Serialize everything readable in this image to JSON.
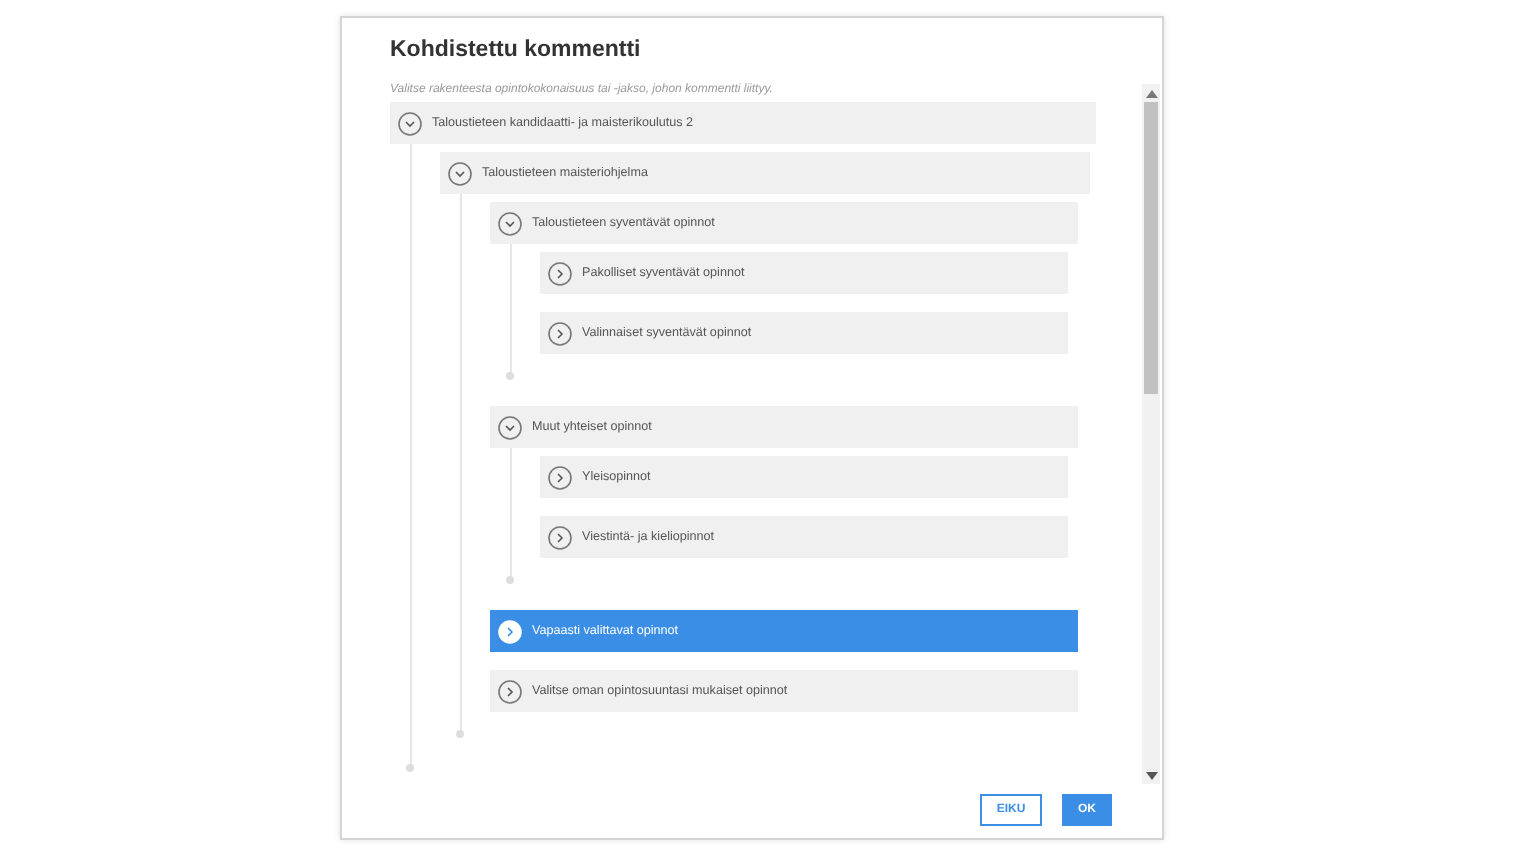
{
  "dialog": {
    "title": "Kohdistettu kommentti",
    "instructions": "Valitse rakenteesta opintokokonaisuus tai -jakso, johon kommentti liittyy.",
    "tree": [
      {
        "label": "Taloustieteen kandidaatti- ja maisterikoulutus 2",
        "expanded": true,
        "selected": false,
        "children": [
          {
            "label": "Taloustieteen maisteriohjelma",
            "expanded": true,
            "selected": false,
            "children": [
              {
                "label": "Taloustieteen syventävät opinnot",
                "expanded": true,
                "selected": false,
                "children": [
                  {
                    "label": "Pakolliset syventävät opinnot",
                    "expanded": false,
                    "selected": false
                  },
                  {
                    "label": "Valinnaiset syventävät opinnot",
                    "expanded": false,
                    "selected": false
                  }
                ]
              },
              {
                "label": "Muut yhteiset opinnot",
                "expanded": true,
                "selected": false,
                "children": [
                  {
                    "label": "Yleisopinnot",
                    "expanded": false,
                    "selected": false
                  },
                  {
                    "label": "Viestintä- ja kieliopinnot",
                    "expanded": false,
                    "selected": false
                  }
                ]
              },
              {
                "label": "Vapaasti valittavat opinnot",
                "expanded": false,
                "selected": true
              },
              {
                "label": "Valitse oman opintosuuntasi mukaiset opinnot",
                "expanded": false,
                "selected": false
              }
            ]
          }
        ]
      }
    ],
    "buttons": [
      {
        "label": "EIKU",
        "kind": "secondary"
      },
      {
        "label": "OK",
        "kind": "primary"
      }
    ]
  }
}
